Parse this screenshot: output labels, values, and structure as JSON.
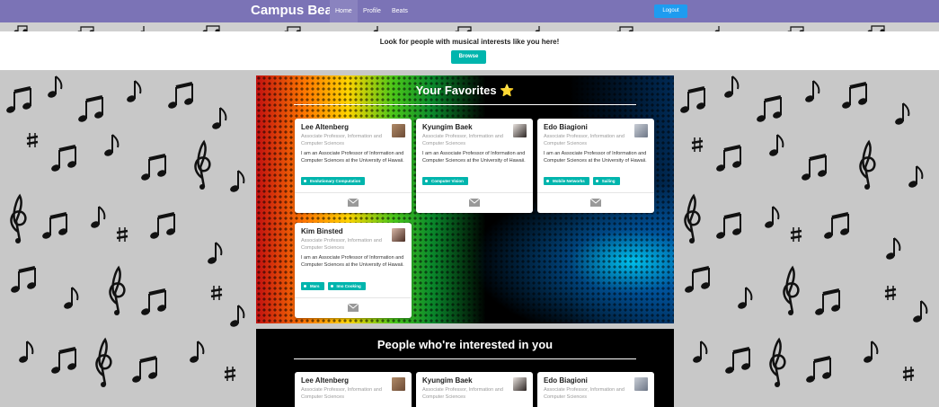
{
  "nav": {
    "brand": "Campus Beats",
    "links": [
      "Home",
      "Profile",
      "Beats"
    ],
    "logout": "Logout"
  },
  "banner": {
    "text": "Look for people with musical interests like you here!",
    "browse": "Browse"
  },
  "favorites": {
    "title": "Your Favorites ⭐",
    "cards": [
      {
        "name": "Lee Altenberg",
        "title": "Associate Professor, Information and Computer Sciences",
        "desc": "I am an Associate Professor of Information and Computer Sciences at the University of Hawaii.",
        "tags": [
          "Evolutionary Computation"
        ]
      },
      {
        "name": "Kyungim Baek",
        "title": "Associate Professor, Information and Computer Sciences",
        "desc": "I am an Associate Professor of Information and Computer Sciences at the University of Hawaii.",
        "tags": [
          "Computer Vision"
        ]
      },
      {
        "name": "Edo Biagioni",
        "title": "Associate Professor, Information and Computer Sciences",
        "desc": "I am an Associate Professor of Information and Computer Sciences at the University of Hawaii.",
        "tags": [
          "Mobile Networks",
          "Sailing"
        ]
      },
      {
        "name": "Kim Binsted",
        "title": "Associate Professor, Information and Computer Sciences",
        "desc": "I am an Associate Professor of Information and Computer Sciences at the University of Hawaii.",
        "tags": [
          "Mars",
          "Imo Cooking"
        ]
      }
    ]
  },
  "interested": {
    "title": "People who're interested in you",
    "cards": [
      {
        "name": "Lee Altenberg",
        "title": "Associate Professor, Information and Computer Sciences"
      },
      {
        "name": "Kyungim Baek",
        "title": "Associate Professor, Information and Computer Sciences"
      },
      {
        "name": "Edo Biagioni",
        "title": "Associate Professor, Information and Computer Sciences"
      }
    ]
  },
  "icons": {
    "card_action": "mail-icon"
  },
  "colors": {
    "nav": "#7b73b6",
    "accent": "#00b5ad",
    "logout": "#1e9cf0"
  }
}
